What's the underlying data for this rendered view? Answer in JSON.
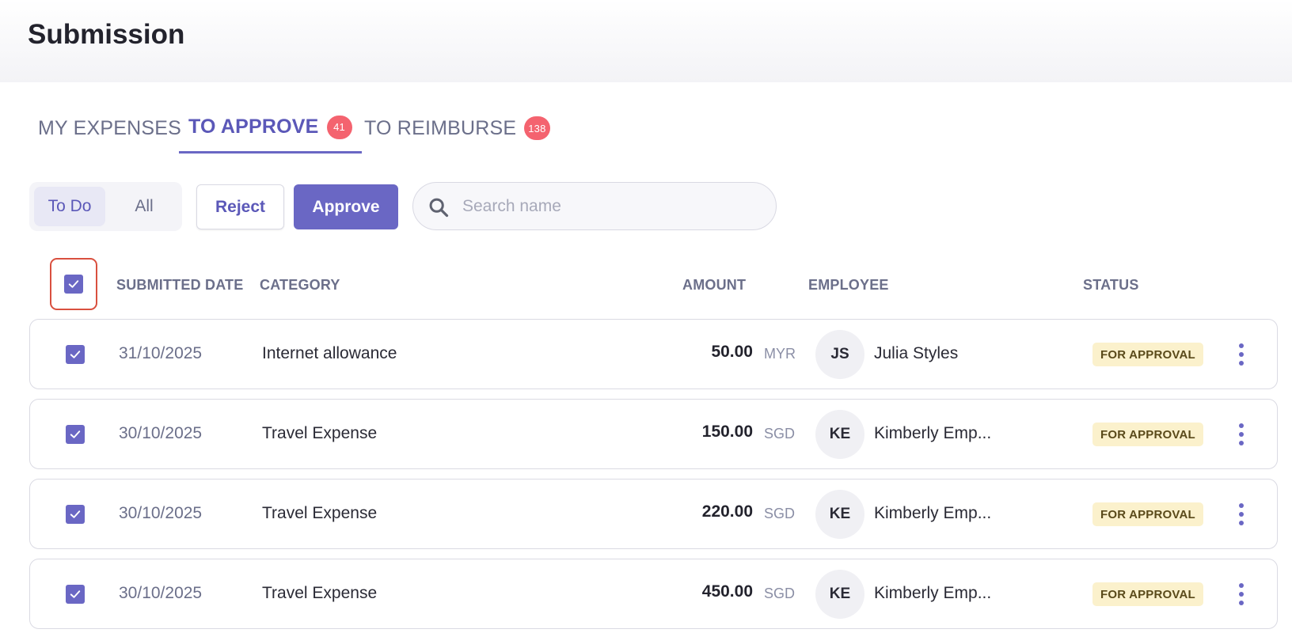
{
  "header": {
    "title": "Submission"
  },
  "tabs": [
    {
      "label": "MY EXPENSES",
      "badge": ""
    },
    {
      "label": "TO APPROVE",
      "badge": "41"
    },
    {
      "label": "TO REIMBURSE",
      "badge": "138"
    }
  ],
  "filter": {
    "todo_label": "To Do",
    "all_label": "All"
  },
  "actions": {
    "reject_label": "Reject",
    "approve_label": "Approve"
  },
  "search": {
    "placeholder": "Search name",
    "value": ""
  },
  "table": {
    "columns": {
      "date": "SUBMITTED DATE",
      "category": "CATEGORY",
      "amount": "AMOUNT",
      "employee": "EMPLOYEE",
      "status": "STATUS"
    },
    "rows": [
      {
        "date": "31/10/2025",
        "category": "Internet allowance",
        "amount": "50.00",
        "currency": "MYR",
        "initials": "JS",
        "employee": "Julia Styles",
        "status": "FOR APPROVAL"
      },
      {
        "date": "30/10/2025",
        "category": "Travel Expense",
        "amount": "150.00",
        "currency": "SGD",
        "initials": "KE",
        "employee": "Kimberly Emp...",
        "status": "FOR APPROVAL"
      },
      {
        "date": "30/10/2025",
        "category": "Travel Expense",
        "amount": "220.00",
        "currency": "SGD",
        "initials": "KE",
        "employee": "Kimberly Emp...",
        "status": "FOR APPROVAL"
      },
      {
        "date": "30/10/2025",
        "category": "Travel Expense",
        "amount": "450.00",
        "currency": "SGD",
        "initials": "KE",
        "employee": "Kimberly Emp...",
        "status": "FOR APPROVAL"
      }
    ]
  },
  "colors": {
    "accent": "#6a67c4",
    "badge": "#f4636f",
    "status_bg": "#fbf1cc",
    "highlight": "#d9503f"
  },
  "icons": {
    "search": "search-icon",
    "check": "check-icon",
    "more": "more-vertical-icon"
  }
}
